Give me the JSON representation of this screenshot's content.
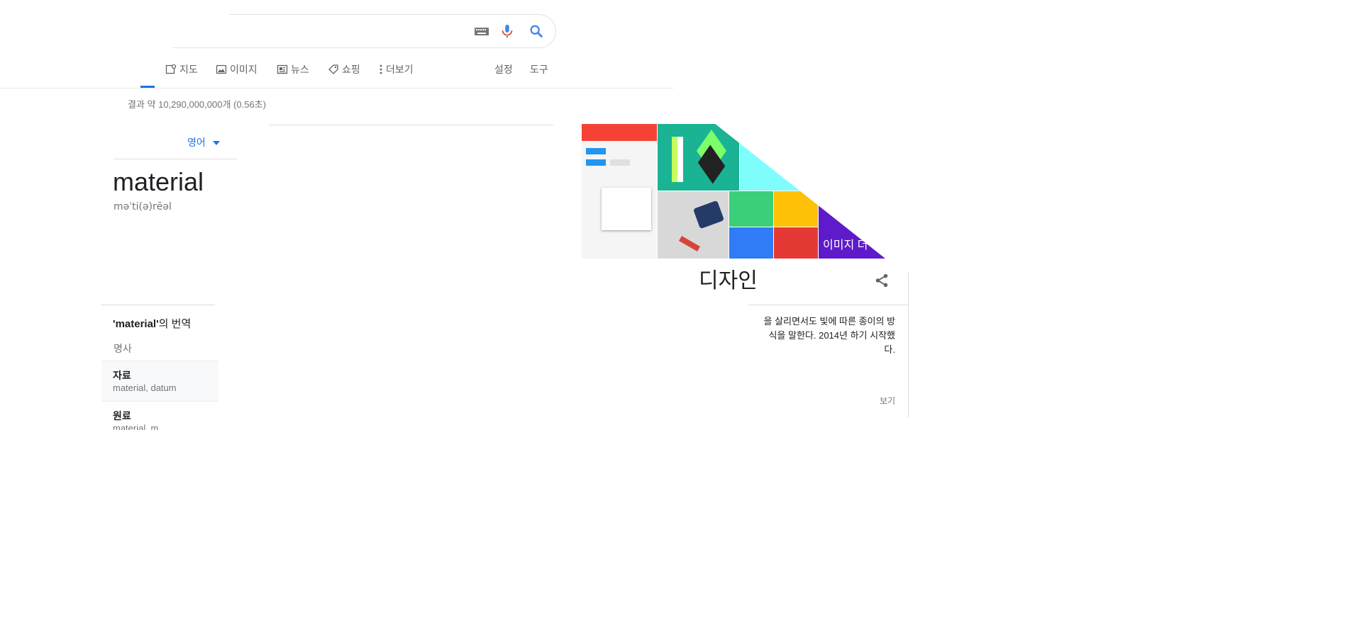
{
  "search": {
    "query": "",
    "keyboard_icon": "keyboard-icon",
    "mic_icon": "microphone-icon",
    "search_icon": "search-icon"
  },
  "tabs": [
    {
      "label": "지도",
      "icon": "map-icon"
    },
    {
      "label": "이미지",
      "icon": "image-icon"
    },
    {
      "label": "뉴스",
      "icon": "news-icon"
    },
    {
      "label": "쇼핑",
      "icon": "tag-icon"
    },
    {
      "label": "더보기",
      "icon": "more-vert-icon"
    },
    {
      "label": "설정"
    },
    {
      "label": "도구"
    }
  ],
  "result_stats": "결과 약 10,290,000,000개 (0.56초)",
  "dictionary": {
    "language": "영어",
    "word": "material",
    "pronunciation": "məˈti(ə)rēəl",
    "translation_title_word": "'material'",
    "translation_title_suffix": "의 번역",
    "part_of_speech": "명사",
    "translations": [
      {
        "word": "자료",
        "synonyms": "material, datum"
      },
      {
        "word": "원료",
        "synonyms": "material, m"
      }
    ]
  },
  "knowledge_panel": {
    "images_more_label": "이미지 더",
    "title": "디자인",
    "description": "을 살리면서도 빛에 따른 종이의 방식을 말한다. 2014년 하기 시작했다.",
    "more_link": "보기",
    "share_icon": "share-icon"
  },
  "colors": {
    "accent_blue": "#1a73e8",
    "text_secondary": "#70757a",
    "border": "#dadce0"
  }
}
